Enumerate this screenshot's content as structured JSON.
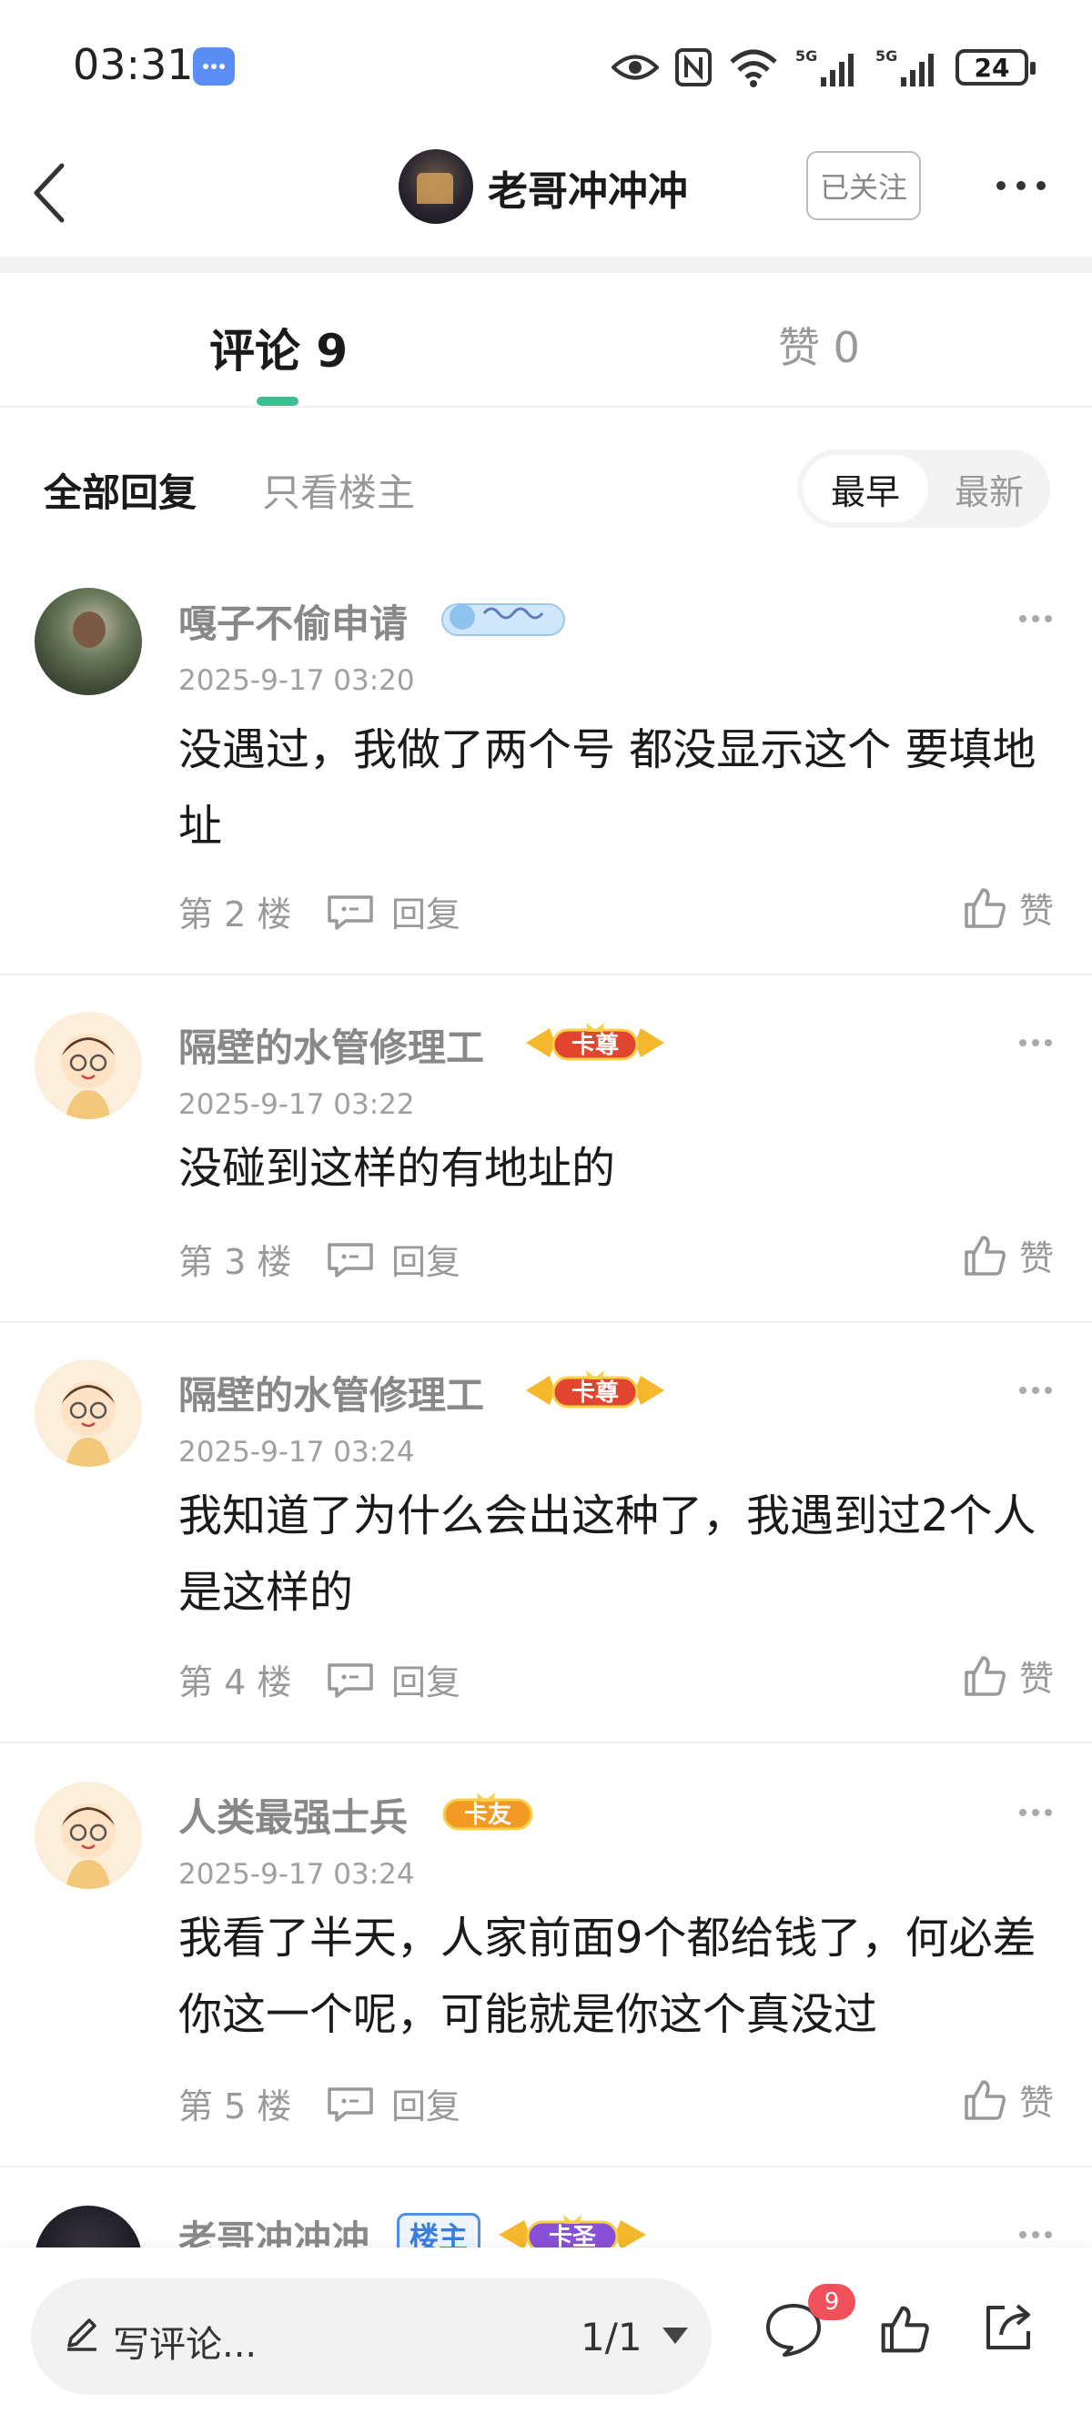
{
  "status_bar": {
    "time": "03:31",
    "battery": "24"
  },
  "header": {
    "username": "老哥冲冲冲",
    "follow_label": "已关注"
  },
  "tabs": {
    "comments_label": "评论 9",
    "likes_label": "赞 0"
  },
  "filters": {
    "all_label": "全部回复",
    "host_only_label": "只看楼主",
    "sort_earliest": "最早",
    "sort_newest": "最新"
  },
  "comments": [
    {
      "username": "嘎子不偷申请",
      "badge": "",
      "time": "2025-9-17 03:20",
      "text": "没遇过，我做了两个号 都没显示这个 要填地址",
      "floor": "第 2 楼",
      "reply_label": "回复",
      "like_label": "赞"
    },
    {
      "username": "隔壁的水管修理工",
      "badge": "卡尊",
      "time": "2025-9-17 03:22",
      "text": "没碰到这样的有地址的",
      "floor": "第 3 楼",
      "reply_label": "回复",
      "like_label": "赞"
    },
    {
      "username": "隔壁的水管修理工",
      "badge": "卡尊",
      "time": "2025-9-17 03:24",
      "text": "我知道了为什么会出这种了，我遇到过2个人是这样的",
      "floor": "第 4 楼",
      "reply_label": "回复",
      "like_label": "赞"
    },
    {
      "username": "人类最强士兵",
      "badge": "卡友",
      "time": "2025-9-17 03:24",
      "text": "我看了半天，人家前面9个都给钱了，何必差你这一个呢，可能就是你这个真没过",
      "floor": "第 5 楼",
      "reply_label": "回复",
      "like_label": "赞"
    },
    {
      "username": "老哥冲冲冲",
      "host_tag": "楼主",
      "badge": "卡圣"
    }
  ],
  "bottom_bar": {
    "write_placeholder": "写评论...",
    "page": "1/1",
    "comment_count": "9"
  }
}
